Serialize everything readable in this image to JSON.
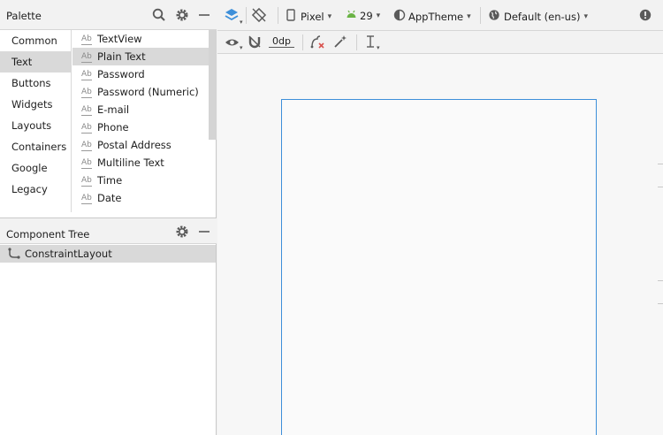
{
  "palette": {
    "title": "Palette",
    "categories": [
      "Common",
      "Text",
      "Buttons",
      "Widgets",
      "Layouts",
      "Containers",
      "Google",
      "Legacy"
    ],
    "selected_category": "Text",
    "item_icon_text": "Ab",
    "items": [
      "TextView",
      "Plain Text",
      "Password",
      "Password (Numeric)",
      "E-mail",
      "Phone",
      "Postal Address",
      "Multiline Text",
      "Time",
      "Date"
    ],
    "selected_item": "Plain Text"
  },
  "component_tree": {
    "title": "Component Tree",
    "root": "ConstraintLayout"
  },
  "toolbar": {
    "device": "Pixel",
    "api_level": "29",
    "theme": "AppTheme",
    "locale": "Default (en-us)",
    "margin": "0dp"
  },
  "colors": {
    "accent": "#3d8fd9",
    "android_green": "#6ab345",
    "selection": "#d9d9d9",
    "icon": "#5a5a5a"
  }
}
